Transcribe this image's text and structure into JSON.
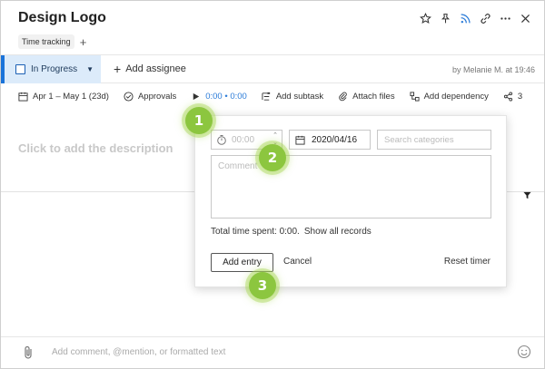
{
  "header": {
    "title": "Design Logo",
    "tag": "Time tracking",
    "tag_add": "+",
    "icons": [
      "star-icon",
      "pin-icon",
      "rss-icon",
      "link-icon",
      "more-icon",
      "close-icon"
    ]
  },
  "status": {
    "label": "In Progress",
    "assignee_label": "Add assignee",
    "byline": "by Melanie M. at 19:46"
  },
  "toolbar": {
    "dates": "Apr 1 – May 1 (23d)",
    "approvals": "Approvals",
    "time": "0:00 • 0:00",
    "add_subtask": "Add subtask",
    "attach_files": "Attach files",
    "add_dependency": "Add dependency",
    "share_count": "3"
  },
  "description": {
    "placeholder": "Click to add the description"
  },
  "comment_bar": {
    "placeholder": "Add comment, @mention, or formatted text"
  },
  "popover": {
    "time_placeholder": "00:00",
    "date_value": "2020/04/16",
    "category_placeholder": "Search categories",
    "comment_placeholder": "Comment",
    "total_text": "Total time spent: 0:00.",
    "show_all": "Show all records",
    "add_entry": "Add entry",
    "cancel": "Cancel",
    "reset_timer": "Reset timer"
  },
  "callouts": [
    "1",
    "2",
    "3"
  ],
  "colors": {
    "accent": "#1a73d9",
    "status_bg": "#dcebfa",
    "callout": "#8cc63f",
    "time_link": "#2a7bd8"
  }
}
